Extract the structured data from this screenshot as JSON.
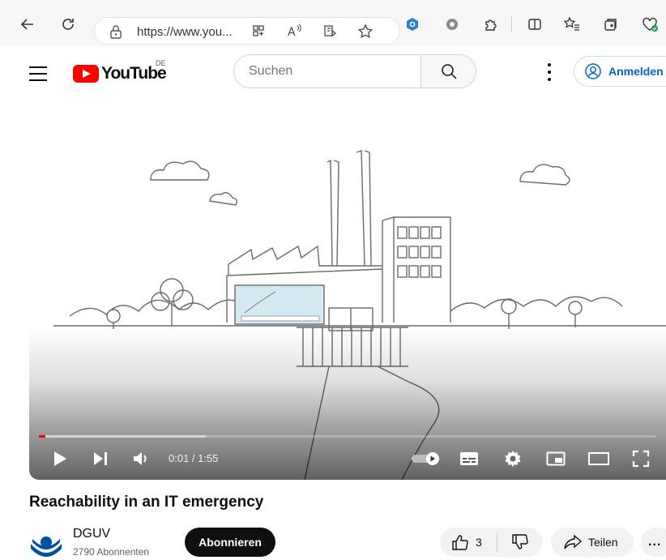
{
  "browser": {
    "url": "https://www.you...",
    "icons": [
      "back-icon",
      "refresh-icon",
      "lock-icon",
      "grid-icon",
      "read-aloud-icon",
      "immersive-reader-icon",
      "favorite-star-icon",
      "extension-hex-icon",
      "extension-gear-icon",
      "extensions-icon",
      "split-screen-icon",
      "favorites-icon",
      "collections-icon",
      "browser-essentials-icon"
    ]
  },
  "header": {
    "logo_text": "YouTube",
    "region": "DE",
    "search_placeholder": "Suchen",
    "signin_label": "Anmelden",
    "accent": "#065fd4",
    "brand": "#ff0000"
  },
  "player": {
    "time": "0:01 / 1:55",
    "progress_played": 0.01,
    "progress_buffered": 0.27,
    "autoplay": "on"
  },
  "video": {
    "title": "Reachability in an IT emergency",
    "channel": "DGUV",
    "subscribers": "2790 Abonnenten",
    "subscribe_label": "Abonnieren",
    "likes": "3",
    "share_label": "Teilen",
    "more_label": "..."
  }
}
